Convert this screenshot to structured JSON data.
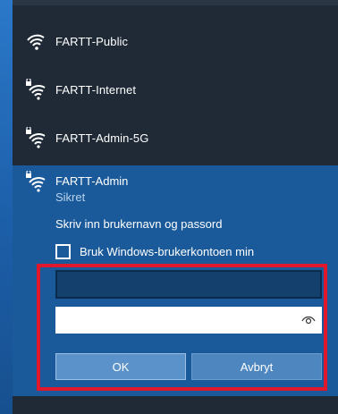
{
  "networks": [
    {
      "name": "FARTT-Public",
      "secured": false,
      "icon": "wifi-icon"
    },
    {
      "name": "FARTT-Internet",
      "secured": true,
      "icon": "wifi-secured-icon"
    },
    {
      "name": "FARTT-Admin-5G",
      "secured": true,
      "icon": "wifi-secured-icon"
    }
  ],
  "expanded": {
    "name": "FARTT-Admin",
    "status": "Sikret",
    "prompt": "Skriv inn brukernavn og passord",
    "checkbox_label": "Bruk Windows-brukerkontoen min",
    "checkbox_checked": false,
    "username_value": "",
    "password_value": "",
    "ok_label": "OK",
    "cancel_label": "Avbryt"
  },
  "colors": {
    "panel": "#1f2a36",
    "selected": "#1b5a9a",
    "highlight_border": "#e0182b",
    "button": "#4e87c0"
  }
}
